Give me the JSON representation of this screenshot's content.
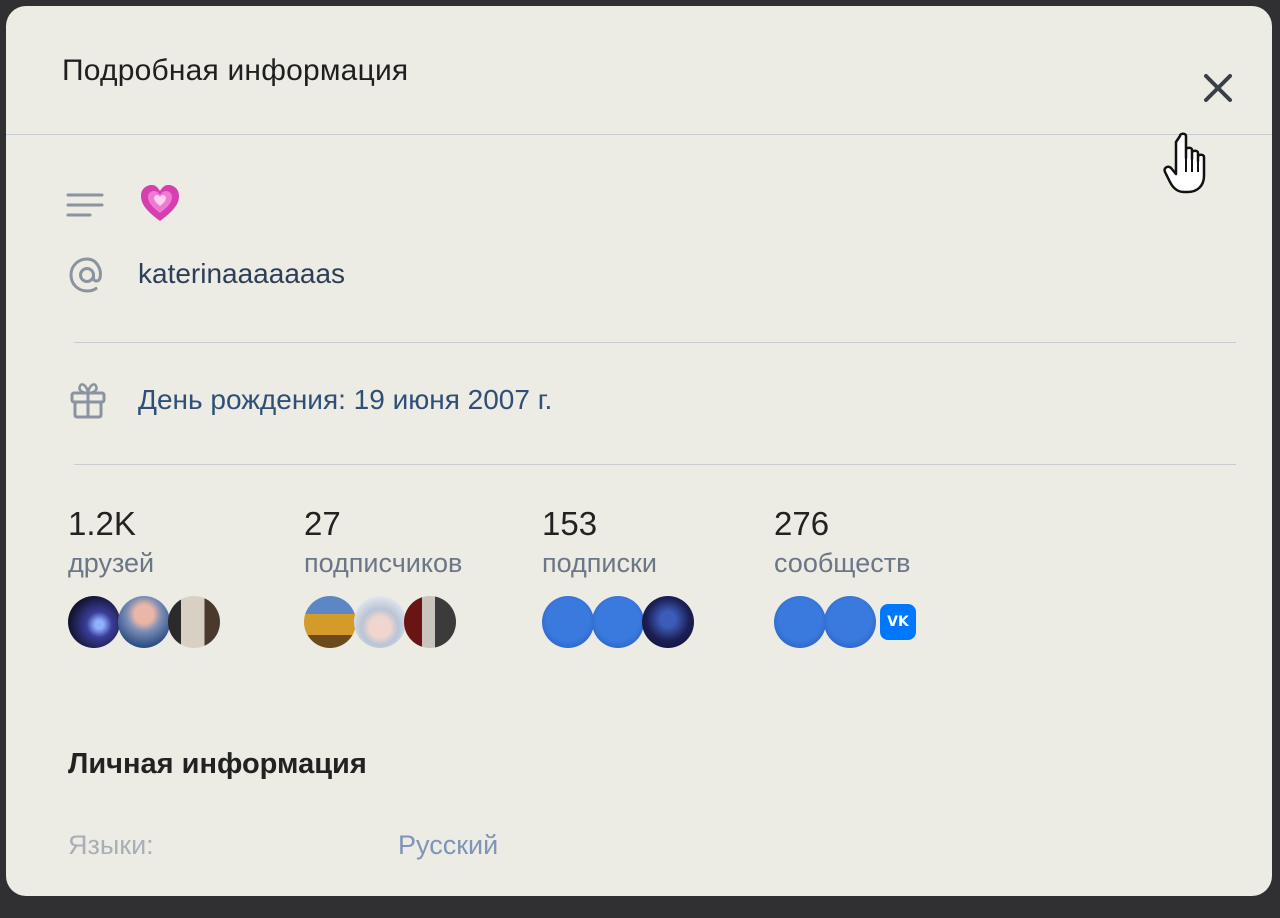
{
  "modal": {
    "title": "Подробная информация",
    "close_icon": "close-icon"
  },
  "profile": {
    "status_icon": "lines-icon",
    "status_emoji": "heart-icon",
    "nickname_icon": "at-icon",
    "nickname": "katerinaaaaaaas",
    "birthday_icon": "gift-icon",
    "birthday": "День рождения: 19 июня 2007 г."
  },
  "counters": [
    {
      "value": "1.2K",
      "label": "друзей"
    },
    {
      "value": "27",
      "label": "подписчиков"
    },
    {
      "value": "153",
      "label": "подписки"
    },
    {
      "value": "276",
      "label": "сообществ"
    }
  ],
  "personal": {
    "title": "Личная информация",
    "languages_label": "Языки:",
    "languages_value": "Русский"
  },
  "colors": {
    "accent_blue": "#2a5fb6",
    "vk_blue": "#0077ff",
    "heart_pink": "#d63fb0"
  }
}
